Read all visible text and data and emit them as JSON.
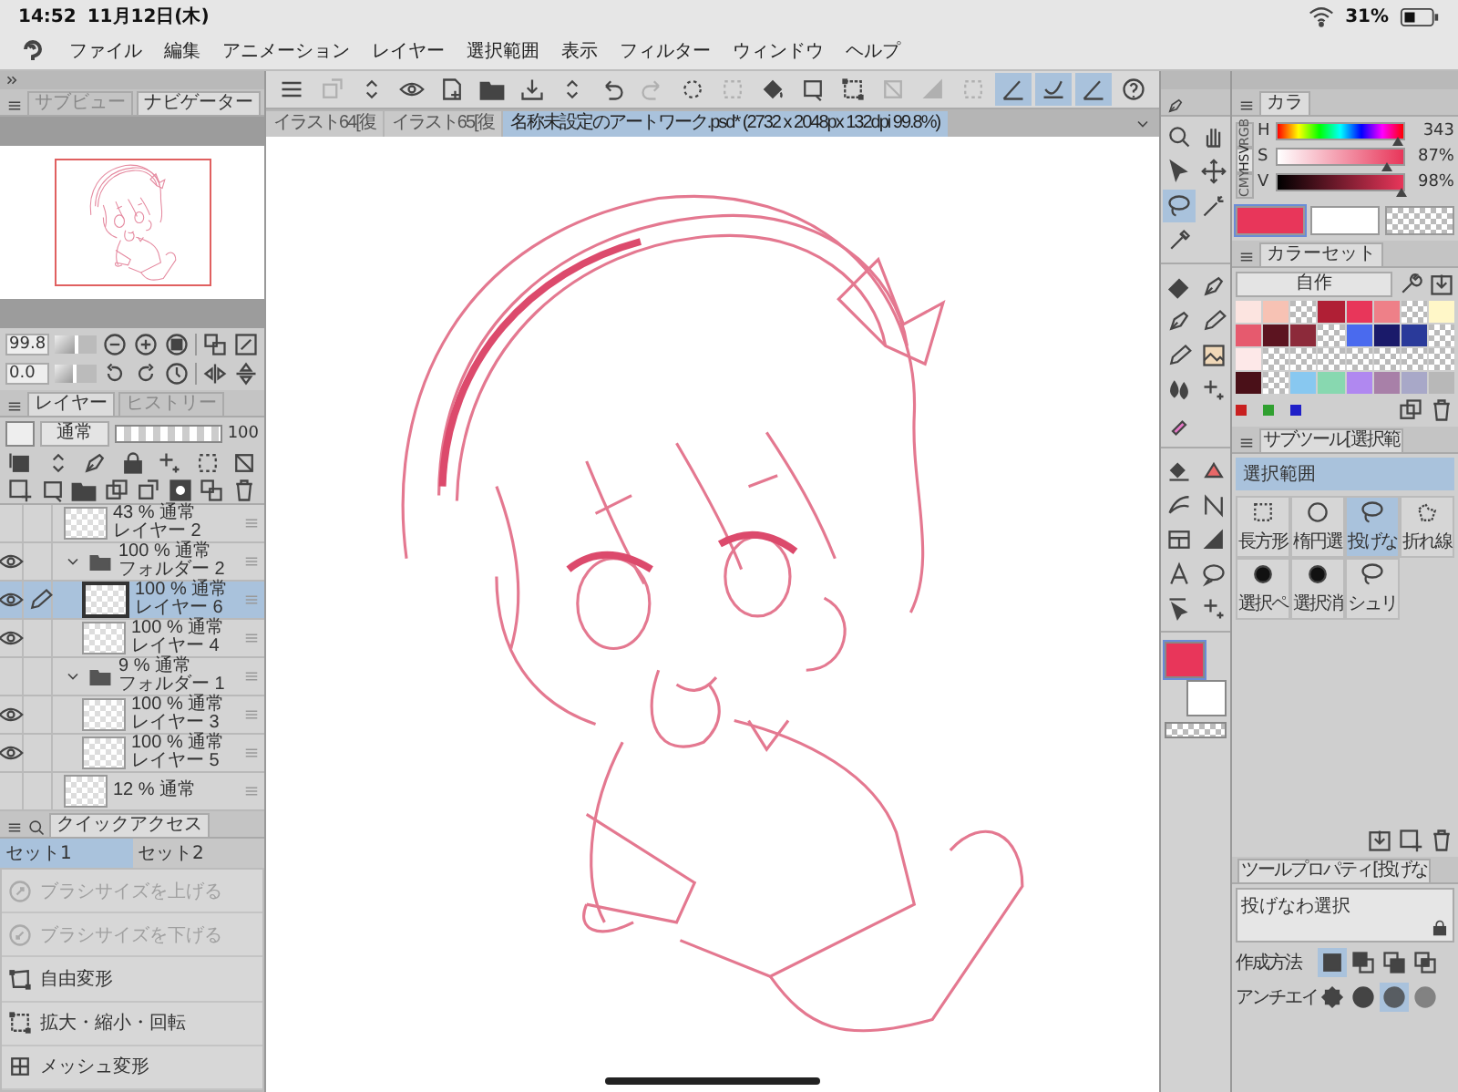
{
  "status_bar": {
    "time": "14:52",
    "date": "11月12日(木)",
    "battery": "31%"
  },
  "menu": [
    "ファイル",
    "編集",
    "アニメーション",
    "レイヤー",
    "選択範囲",
    "表示",
    "フィルター",
    "ウィンドウ",
    "ヘルプ"
  ],
  "toolbar": [
    {
      "kind": "menu",
      "on": false,
      "disabled": false
    },
    {
      "kind": "layerprops",
      "on": false,
      "disabled": true
    },
    {
      "kind": "updown",
      "on": false,
      "disabled": false
    },
    {
      "kind": "eye",
      "on": false,
      "disabled": false
    },
    {
      "kind": "newfile",
      "on": false,
      "disabled": false
    },
    {
      "kind": "folder",
      "on": false,
      "disabled": false
    },
    {
      "kind": "save",
      "on": false,
      "disabled": false
    },
    {
      "kind": "updown",
      "on": false,
      "disabled": false
    },
    {
      "kind": "undo",
      "on": false,
      "disabled": false
    },
    {
      "kind": "redo",
      "on": false,
      "disabled": true
    },
    {
      "kind": "dotcircle",
      "on": false,
      "disabled": false
    },
    {
      "kind": "dashsquare",
      "on": false,
      "disabled": true
    },
    {
      "kind": "bucket",
      "on": false,
      "disabled": false
    },
    {
      "kind": "crop",
      "on": false,
      "disabled": false
    },
    {
      "kind": "transform",
      "on": false,
      "disabled": false
    },
    {
      "kind": "grid",
      "on": false,
      "disabled": true
    },
    {
      "kind": "gradient",
      "on": false,
      "disabled": true
    },
    {
      "kind": "dashsquare",
      "on": false,
      "disabled": true
    },
    {
      "kind": "ruler",
      "on": true,
      "disabled": false
    },
    {
      "kind": "curveruler",
      "on": true,
      "disabled": false
    },
    {
      "kind": "ruler",
      "on": true,
      "disabled": false
    },
    {
      "kind": "help",
      "on": false,
      "disabled": false
    }
  ],
  "navigator": {
    "tabs": [
      {
        "label": "サブビュー",
        "selected": false
      },
      {
        "label": "ナビゲーター",
        "selected": true
      }
    ],
    "zoom": {
      "value": "99.8",
      "level": 0.55
    },
    "angle": {
      "value": "0.0",
      "level": 0.5
    }
  },
  "layer_panel": {
    "tabs": [
      {
        "label": "レイヤー",
        "selected": true
      },
      {
        "label": "ヒストリー",
        "selected": false
      }
    ],
    "blend_mode": "通常",
    "opacity": {
      "value": "100",
      "level": 1.0
    },
    "layers": [
      {
        "kind": "layer",
        "info": "43 % 通常",
        "name": "レイヤー 2",
        "visible": false,
        "selected": false
      },
      {
        "kind": "folder",
        "info": "100 % 通常",
        "name": "フォルダー 2",
        "visible": true,
        "selected": false,
        "expanded": true,
        "children": [
          {
            "kind": "layer",
            "info": "100 % 通常",
            "name": "レイヤー 6",
            "visible": true,
            "selected": true
          },
          {
            "kind": "layer",
            "info": "100 % 通常",
            "name": "レイヤー 4",
            "visible": true,
            "selected": false
          }
        ]
      },
      {
        "kind": "folder",
        "info": "9 % 通常",
        "name": "フォルダー 1",
        "visible": false,
        "selected": false,
        "expanded": true,
        "children": [
          {
            "kind": "layer",
            "info": "100 % 通常",
            "name": "レイヤー 3",
            "visible": true,
            "selected": false
          },
          {
            "kind": "layer",
            "info": "100 % 通常",
            "name": "レイヤー 5",
            "visible": true,
            "selected": false
          }
        ]
      },
      {
        "kind": "layer",
        "info": "12 % 通常",
        "visible": false,
        "selected": false
      }
    ]
  },
  "quick_access": {
    "title": "クイックアクセス",
    "sets": [
      {
        "label": "セット1",
        "selected": true
      },
      {
        "label": "セット2",
        "selected": false
      }
    ],
    "items": [
      {
        "label": "ブラシサイズを上げる",
        "kind": "brushup",
        "disabled": true
      },
      {
        "label": "ブラシサイズを下げる",
        "kind": "brushdown",
        "disabled": true
      },
      {
        "label": "自由変形",
        "kind": "freetransform",
        "disabled": false
      },
      {
        "label": "拡大・縮小・回転",
        "kind": "transform",
        "disabled": false
      },
      {
        "label": "メッシュ変形",
        "kind": "mesh",
        "disabled": false
      }
    ]
  },
  "document_tabs": [
    {
      "label": "イラスト64[復",
      "selected": false
    },
    {
      "label": "イラスト65[復",
      "selected": false
    },
    {
      "label": "名称未設定のアートワーク.psd* (2732 x 2048px 132dpi 99.8%)",
      "selected": true
    }
  ],
  "tool_palette": {
    "groups": [
      {
        "tools": [
          {
            "kind": "magnifier",
            "selected": false
          },
          {
            "kind": "hand",
            "selected": false
          },
          {
            "kind": "cursor",
            "selected": false
          },
          {
            "kind": "move",
            "selected": false
          },
          {
            "kind": "lasso",
            "selected": true
          },
          {
            "kind": "wand",
            "selected": false
          },
          {
            "kind": "dropper",
            "selected": false
          }
        ]
      },
      {
        "tools": [
          {
            "kind": "eraser",
            "selected": false
          },
          {
            "kind": "pen",
            "selected": false
          },
          {
            "kind": "pen",
            "selected": false
          },
          {
            "kind": "pencil",
            "selected": false
          },
          {
            "kind": "pencil",
            "selected": false
          },
          {
            "kind": "picture",
            "selected": false
          },
          {
            "kind": "drops",
            "selected": false
          },
          {
            "kind": "sparkle",
            "selected": false
          },
          {
            "kind": "marker",
            "selected": false
          }
        ]
      },
      {
        "tools": [
          {
            "kind": "filllayer",
            "selected": false
          },
          {
            "kind": "slice",
            "selected": false
          },
          {
            "kind": "stroke",
            "selected": false
          },
          {
            "kind": "vector",
            "selected": false
          },
          {
            "kind": "frame",
            "selected": false
          },
          {
            "kind": "gradient",
            "selected": false
          },
          {
            "kind": "text",
            "selected": false
          },
          {
            "kind": "balloon",
            "selected": false
          },
          {
            "kind": "selarrow",
            "selected": false
          },
          {
            "kind": "sparkle",
            "selected": false
          }
        ]
      }
    ],
    "colors": [
      {
        "kind": "main",
        "color": "#e8365a",
        "selected": true
      },
      {
        "kind": "sub",
        "color": "#ffffff",
        "selected": false
      },
      {
        "kind": "transparent",
        "selected": false
      }
    ]
  },
  "color_panel": {
    "tab": "カラ",
    "modes": [
      {
        "label": "RGB",
        "selected": false
      },
      {
        "label": "HSV",
        "selected": true
      },
      {
        "label": "CMY",
        "selected": false
      }
    ],
    "sliders": [
      {
        "kind": "hue",
        "label": "H",
        "reading": "343",
        "level": 0.95
      },
      {
        "kind": "saturation",
        "label": "S",
        "reading": "87%",
        "level": 0.87
      },
      {
        "kind": "value",
        "label": "V",
        "reading": "98%",
        "level": 0.98
      }
    ],
    "colors": [
      {
        "kind": "main",
        "color": "#e8365a",
        "selected": true
      },
      {
        "kind": "sub",
        "color": "#ffffff",
        "selected": false
      },
      {
        "kind": "transparent",
        "selected": false
      }
    ]
  },
  "color_set": {
    "tab": "カラーセット",
    "set_name": "自作",
    "swatches": [
      {
        "kind": "color",
        "color": "#fce4e0"
      },
      {
        "kind": "color",
        "color": "#f7c2b4"
      },
      {
        "kind": "empty"
      },
      {
        "kind": "color",
        "color": "#b01f35"
      },
      {
        "kind": "color",
        "color": "#e8365a"
      },
      {
        "kind": "color",
        "color": "#ee8088"
      },
      {
        "kind": "empty"
      },
      {
        "kind": "color",
        "color": "#fff7c8"
      },
      {
        "kind": "color",
        "color": "#e65a6e"
      },
      {
        "kind": "color",
        "color": "#5c1420"
      },
      {
        "kind": "color",
        "color": "#8c2a3a"
      },
      {
        "kind": "empty"
      },
      {
        "kind": "color",
        "color": "#4a6aee"
      },
      {
        "kind": "color",
        "color": "#1a1a6a"
      },
      {
        "kind": "color",
        "color": "#2a3a9a"
      },
      {
        "kind": "empty"
      },
      {
        "kind": "color",
        "color": "#fde8e8"
      },
      {
        "kind": "empty"
      },
      {
        "kind": "empty"
      },
      {
        "kind": "empty"
      },
      {
        "kind": "empty"
      },
      {
        "kind": "empty"
      },
      {
        "kind": "empty"
      },
      {
        "kind": "empty"
      },
      {
        "kind": "color",
        "color": "#4a1018"
      },
      {
        "kind": "empty"
      },
      {
        "kind": "color",
        "color": "#88c8f0"
      },
      {
        "kind": "color",
        "color": "#88d8b0"
      },
      {
        "kind": "color",
        "color": "#b088f0"
      },
      {
        "kind": "color",
        "color": "#a880a8"
      },
      {
        "kind": "color",
        "color": "#a8a8c8"
      },
      {
        "kind": "color",
        "color": "#b8b8b8"
      }
    ]
  },
  "sub_tool": {
    "tab": "サブツール[選択範",
    "group": "選択範囲",
    "tools": [
      {
        "label": "長方形",
        "kind": "rect",
        "selected": false
      },
      {
        "label": "楕円選",
        "kind": "ellipse",
        "selected": false
      },
      {
        "label": "投げな",
        "kind": "lasso",
        "selected": true
      },
      {
        "label": "折れ線",
        "kind": "polyline",
        "selected": false
      },
      {
        "label": "選択ペ",
        "kind": "dot",
        "selected": false
      },
      {
        "label": "選択消",
        "kind": "dot",
        "selected": false
      },
      {
        "label": "シュリ",
        "kind": "lasso",
        "selected": false
      }
    ]
  },
  "tool_property": {
    "tab": "ツールプロパティ[投げな",
    "tool_name": "投げなわ選択",
    "rows": [
      {
        "label": "作成方法",
        "options": [
          {
            "kind": "selnew",
            "selected": true
          },
          {
            "kind": "seladd",
            "selected": false
          },
          {
            "kind": "selsub",
            "selected": false
          },
          {
            "kind": "selint",
            "selected": false
          }
        ]
      },
      {
        "label": "アンチエイ",
        "options": [
          {
            "kind": "aanone",
            "selected": false
          },
          {
            "kind": "aaweak",
            "selected": false
          },
          {
            "kind": "aamid",
            "selected": true
          },
          {
            "kind": "aastrong",
            "selected": false
          }
        ]
      }
    ]
  }
}
